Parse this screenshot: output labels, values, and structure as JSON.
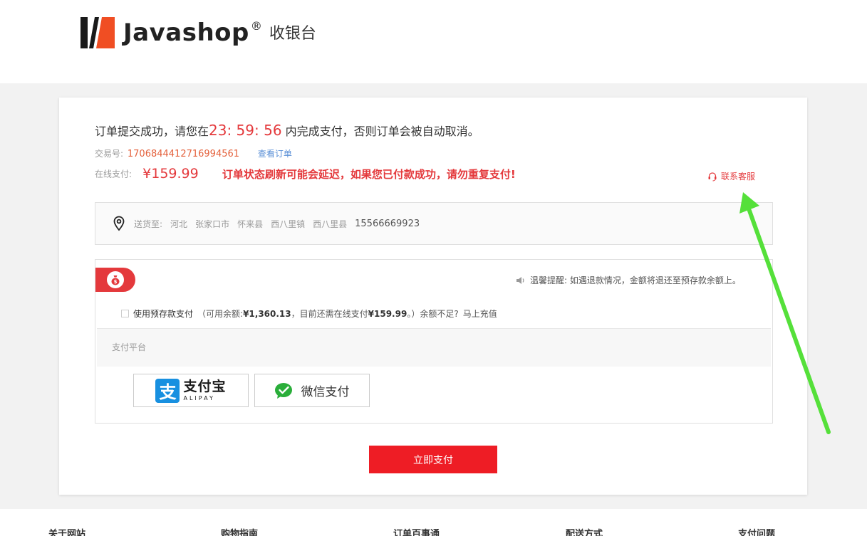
{
  "header": {
    "brand": "Javashop",
    "registered": "®",
    "subtitle": "收银台"
  },
  "order": {
    "message_prefix": "订单提交成功，请您在",
    "countdown": "23: 59: 56",
    "message_suffix": " 内完成支付，否则订单会被自动取消。",
    "trade_label": "交易号:",
    "trade_sn": "1706844412716994561",
    "view_order": "查看订单",
    "online_label": "在线支付:",
    "amount": "¥159.99",
    "warning": "订单状态刷新可能会延迟，如果您已付款成功，请勿重复支付!",
    "service_label": "联系客服"
  },
  "address": {
    "label": "送货至:",
    "province": "河北",
    "city": "张家口市",
    "county": "怀来县",
    "town": "西八里镇",
    "detail": "西八里县",
    "phone": "15566669923"
  },
  "wallet": {
    "reminder": "温馨提醒: 如遇退款情况，金额将退还至预存款余额上。",
    "use_deposit": "使用预存款支付",
    "balance_prefix": "（可用余额:",
    "balance": "¥1,360.13",
    "balance_mid": "，目前还需在线支付",
    "need_online": "¥159.99",
    "balance_suffix": "。）余额不足?",
    "recharge": "马上充值"
  },
  "platform": {
    "title": "支付平台",
    "alipay_cn": "支付宝",
    "alipay_en": "ALIPAY",
    "wechat": "微信支付"
  },
  "pay_button": "立即支付",
  "footer": [
    "关于网站",
    "购物指南",
    "订单百事通",
    "配送方式",
    "支付问题"
  ],
  "colors": {
    "accent_red": "#e4393c",
    "button_red": "#ee1d25",
    "annotation_green": "#55e03a"
  }
}
